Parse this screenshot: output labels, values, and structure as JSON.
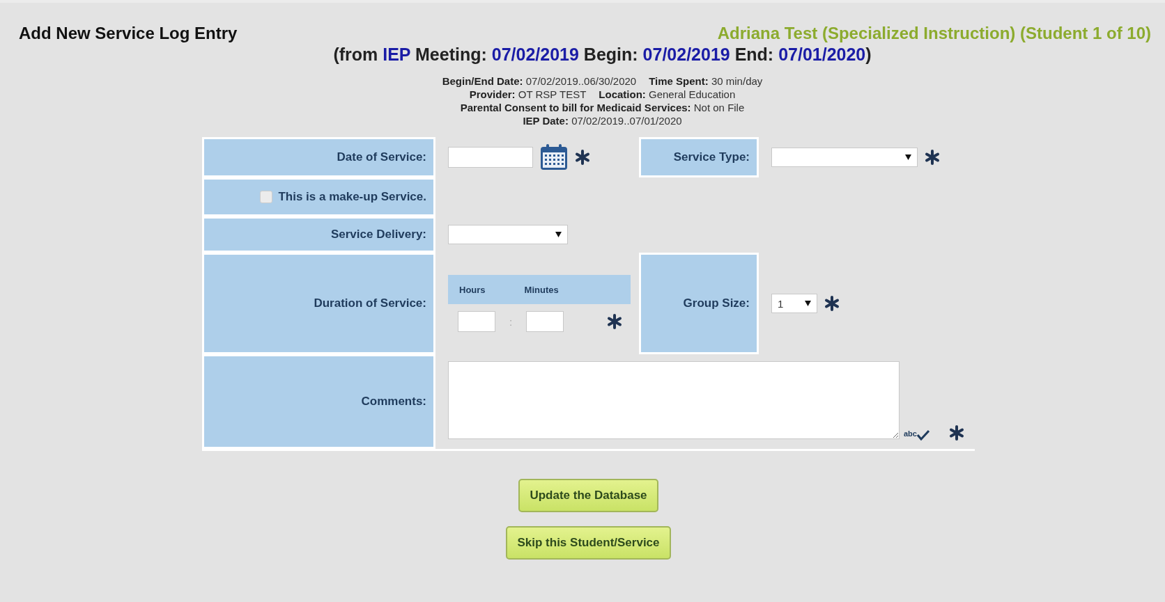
{
  "header": {
    "title": "Add New Service Log Entry",
    "student": "Adriana Test (Specialized Instruction) (Student 1 of 10)",
    "subtitle": [
      {
        "kind": "label",
        "text": "(from"
      },
      {
        "kind": "value",
        "text": "IEP"
      },
      {
        "kind": "label",
        "text": "Meeting:"
      },
      {
        "kind": "value",
        "text": "07/02/2019"
      },
      {
        "kind": "label",
        "text": "Begin:"
      },
      {
        "kind": "value",
        "text": "07/02/2019"
      },
      {
        "kind": "label",
        "text": "End:"
      },
      {
        "kind": "value",
        "text": "07/01/2020"
      },
      {
        "kind": "label",
        "text": ")"
      }
    ]
  },
  "info": [
    [
      {
        "label": "Begin/End Date:",
        "value": "07/02/2019..06/30/2020"
      },
      {
        "label": "Time Spent:",
        "value": "30 min/day"
      }
    ],
    [
      {
        "label": "Provider:",
        "value": "OT RSP TEST"
      },
      {
        "label": "Location:",
        "value": "General Education"
      }
    ],
    [
      {
        "label": "Parental Consent to bill for Medicaid Services:",
        "value": "Not on File"
      }
    ],
    [
      {
        "label": "IEP Date:",
        "value": "07/02/2019..07/01/2020"
      }
    ]
  ],
  "form": {
    "date_of_service": {
      "label": "Date of Service:",
      "required": true
    },
    "service_type": {
      "label": "Service Type:",
      "required": true
    },
    "makeup": {
      "label": "This is a make-up Service.",
      "checked": false
    },
    "service_delivery": {
      "label": "Service Delivery:",
      "required": false
    },
    "duration": {
      "label": "Duration of Service:",
      "hours_label": "Hours",
      "minutes_label": "Minutes",
      "separator": ":",
      "required": true
    },
    "group_size": {
      "label": "Group Size:",
      "value": "1",
      "required": true
    },
    "comments": {
      "label": "Comments:",
      "spellcheck": "abc",
      "required": true
    }
  },
  "buttons": [
    "Update the Database",
    "Skip this Student/Service"
  ]
}
